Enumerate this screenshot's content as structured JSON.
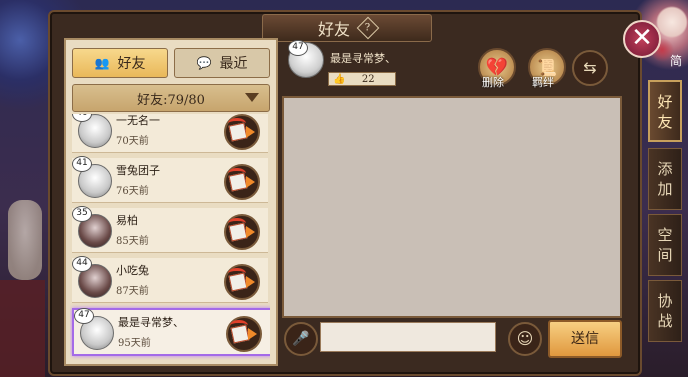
{
  "header": {
    "title": "好友",
    "help_glyph": "?"
  },
  "close_glyph": "✕",
  "tabs": [
    {
      "label": "好友",
      "active": true
    },
    {
      "label": "最近",
      "active": false
    }
  ],
  "friend_count": "好友:79/80",
  "friends": [
    {
      "level": "40",
      "name": "一无名一",
      "last_seen": "70天前"
    },
    {
      "level": "41",
      "name": "雪兔团子",
      "last_seen": "76天前"
    },
    {
      "level": "35",
      "name": "易柏",
      "last_seen": "85天前"
    },
    {
      "level": "44",
      "name": "小吃兔",
      "last_seen": "87天前"
    },
    {
      "level": "47",
      "name": "最是寻常梦、",
      "last_seen": "95天前",
      "selected": true
    }
  ],
  "selected_friend": {
    "level": "47",
    "name": "最是寻常梦、",
    "likes": "22"
  },
  "actions": {
    "delete_label": "删除",
    "bond_label": "羁绊"
  },
  "input": {
    "placeholder": ""
  },
  "send_label": "送信",
  "side_tabs": [
    {
      "label": "好友",
      "active": true
    },
    {
      "label": "添加",
      "active": false
    },
    {
      "label": "空间",
      "active": false
    },
    {
      "label": "协战",
      "active": false
    }
  ],
  "bg_char_text": "简",
  "colors": {
    "accent": "#e9b85a",
    "selected_border": "#a46ae8",
    "close": "#c2405a"
  }
}
